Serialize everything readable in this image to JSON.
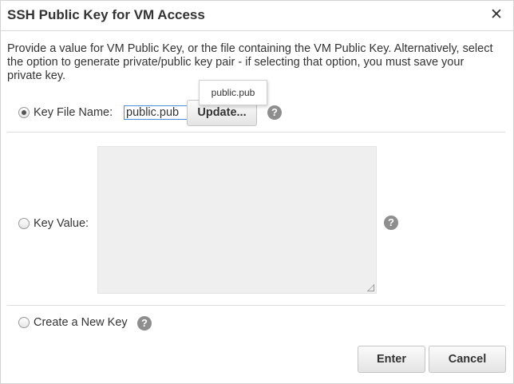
{
  "dialog": {
    "title": "SSH Public Key for VM Access",
    "close_icon": "close-icon",
    "description": "Provide a value for VM Public Key, or the file containing the VM Public Key. Alternatively, select the option to generate private/public key pair - if selecting that option, you must save your private key."
  },
  "key_file": {
    "label": "Key File Name:",
    "selected": true,
    "value": "public.pub",
    "update_label": "Update...",
    "tooltip": "public.pub",
    "help_icon": "question-mark-icon"
  },
  "key_value": {
    "label": "Key Value:",
    "selected": false,
    "value": "",
    "help_icon": "question-mark-icon"
  },
  "new_key": {
    "label": "Create a New Key",
    "selected": false,
    "help_icon": "question-mark-icon"
  },
  "footer": {
    "enter_label": "Enter",
    "cancel_label": "Cancel"
  },
  "colors": {
    "input_focus_border": "#4a90d9",
    "help_icon_bg": "#8e8e8e",
    "textarea_bg": "#efefef"
  }
}
